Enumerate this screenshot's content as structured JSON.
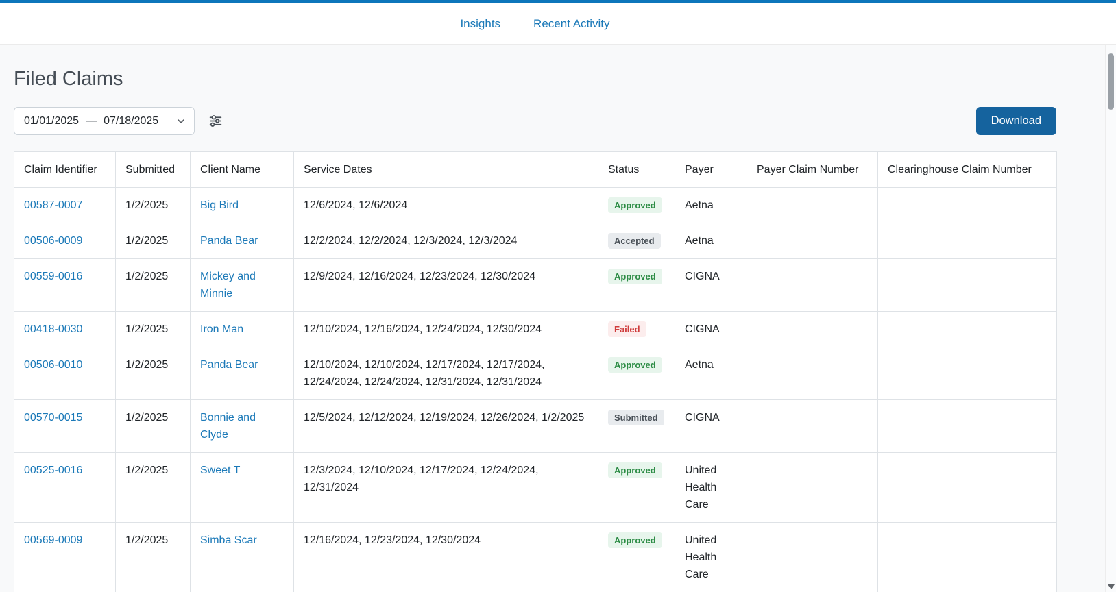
{
  "colors": {
    "top_bar": "#0d76bb",
    "link_blue": "#1b79b8",
    "download_button_bg": "#15639e",
    "approved_bg": "#e7f5ec",
    "approved_text": "#2c8c45",
    "accepted_bg": "#e8ebee",
    "accepted_text": "#495057",
    "failed_bg": "#fceded",
    "failed_text": "#cf3c3c",
    "submitted_bg": "#e8ebee",
    "submitted_text": "#495057"
  },
  "nav": {
    "links": [
      {
        "label": "Insights"
      },
      {
        "label": "Recent Activity"
      }
    ]
  },
  "page": {
    "title": "Filed Claims",
    "toolbar": {
      "date_start": "01/01/2025",
      "date_separator": "—",
      "date_end": "07/18/2025",
      "download_label": "Download",
      "icons": [
        "chevron-down-icon",
        "filter-sliders-icon"
      ]
    }
  },
  "table": {
    "columns": [
      "Claim Identifier",
      "Submitted",
      "Client Name",
      "Service Dates",
      "Status",
      "Payer",
      "Payer Claim Number",
      "Clearinghouse Claim Number"
    ],
    "rows": [
      {
        "claim_id": "00587-0007",
        "submitted": "1/2/2025",
        "client": "Big Bird",
        "service_dates": "12/6/2024, 12/6/2024",
        "status": "Approved",
        "payer": "Aetna",
        "payer_claim_number": "",
        "clearinghouse_claim_number": ""
      },
      {
        "claim_id": "00506-0009",
        "submitted": "1/2/2025",
        "client": "Panda Bear",
        "service_dates": "12/2/2024, 12/2/2024, 12/3/2024, 12/3/2024",
        "status": "Accepted",
        "payer": "Aetna",
        "payer_claim_number": "",
        "clearinghouse_claim_number": ""
      },
      {
        "claim_id": "00559-0016",
        "submitted": "1/2/2025",
        "client": "Mickey and Minnie",
        "service_dates": "12/9/2024, 12/16/2024, 12/23/2024, 12/30/2024",
        "status": "Approved",
        "payer": "CIGNA",
        "payer_claim_number": "",
        "clearinghouse_claim_number": ""
      },
      {
        "claim_id": "00418-0030",
        "submitted": "1/2/2025",
        "client": "Iron Man",
        "service_dates": "12/10/2024, 12/16/2024, 12/24/2024, 12/30/2024",
        "status": "Failed",
        "payer": "CIGNA",
        "payer_claim_number": "",
        "clearinghouse_claim_number": ""
      },
      {
        "claim_id": "00506-0010",
        "submitted": "1/2/2025",
        "client": "Panda Bear",
        "service_dates": "12/10/2024, 12/10/2024, 12/17/2024, 12/17/2024, 12/24/2024, 12/24/2024, 12/31/2024, 12/31/2024",
        "status": "Approved",
        "payer": "Aetna",
        "payer_claim_number": "",
        "clearinghouse_claim_number": ""
      },
      {
        "claim_id": "00570-0015",
        "submitted": "1/2/2025",
        "client": "Bonnie and Clyde",
        "service_dates": "12/5/2024, 12/12/2024, 12/19/2024, 12/26/2024, 1/2/2025",
        "status": "Submitted",
        "payer": "CIGNA",
        "payer_claim_number": "",
        "clearinghouse_claim_number": ""
      },
      {
        "claim_id": "00525-0016",
        "submitted": "1/2/2025",
        "client": "Sweet T",
        "service_dates": "12/3/2024, 12/10/2024, 12/17/2024, 12/24/2024, 12/31/2024",
        "status": "Approved",
        "payer": "United Health Care",
        "payer_claim_number": "",
        "clearinghouse_claim_number": ""
      },
      {
        "claim_id": "00569-0009",
        "submitted": "1/2/2025",
        "client": "Simba Scar",
        "service_dates": "12/16/2024, 12/23/2024, 12/30/2024",
        "status": "Approved",
        "payer": "United Health Care",
        "payer_claim_number": "",
        "clearinghouse_claim_number": ""
      }
    ]
  }
}
